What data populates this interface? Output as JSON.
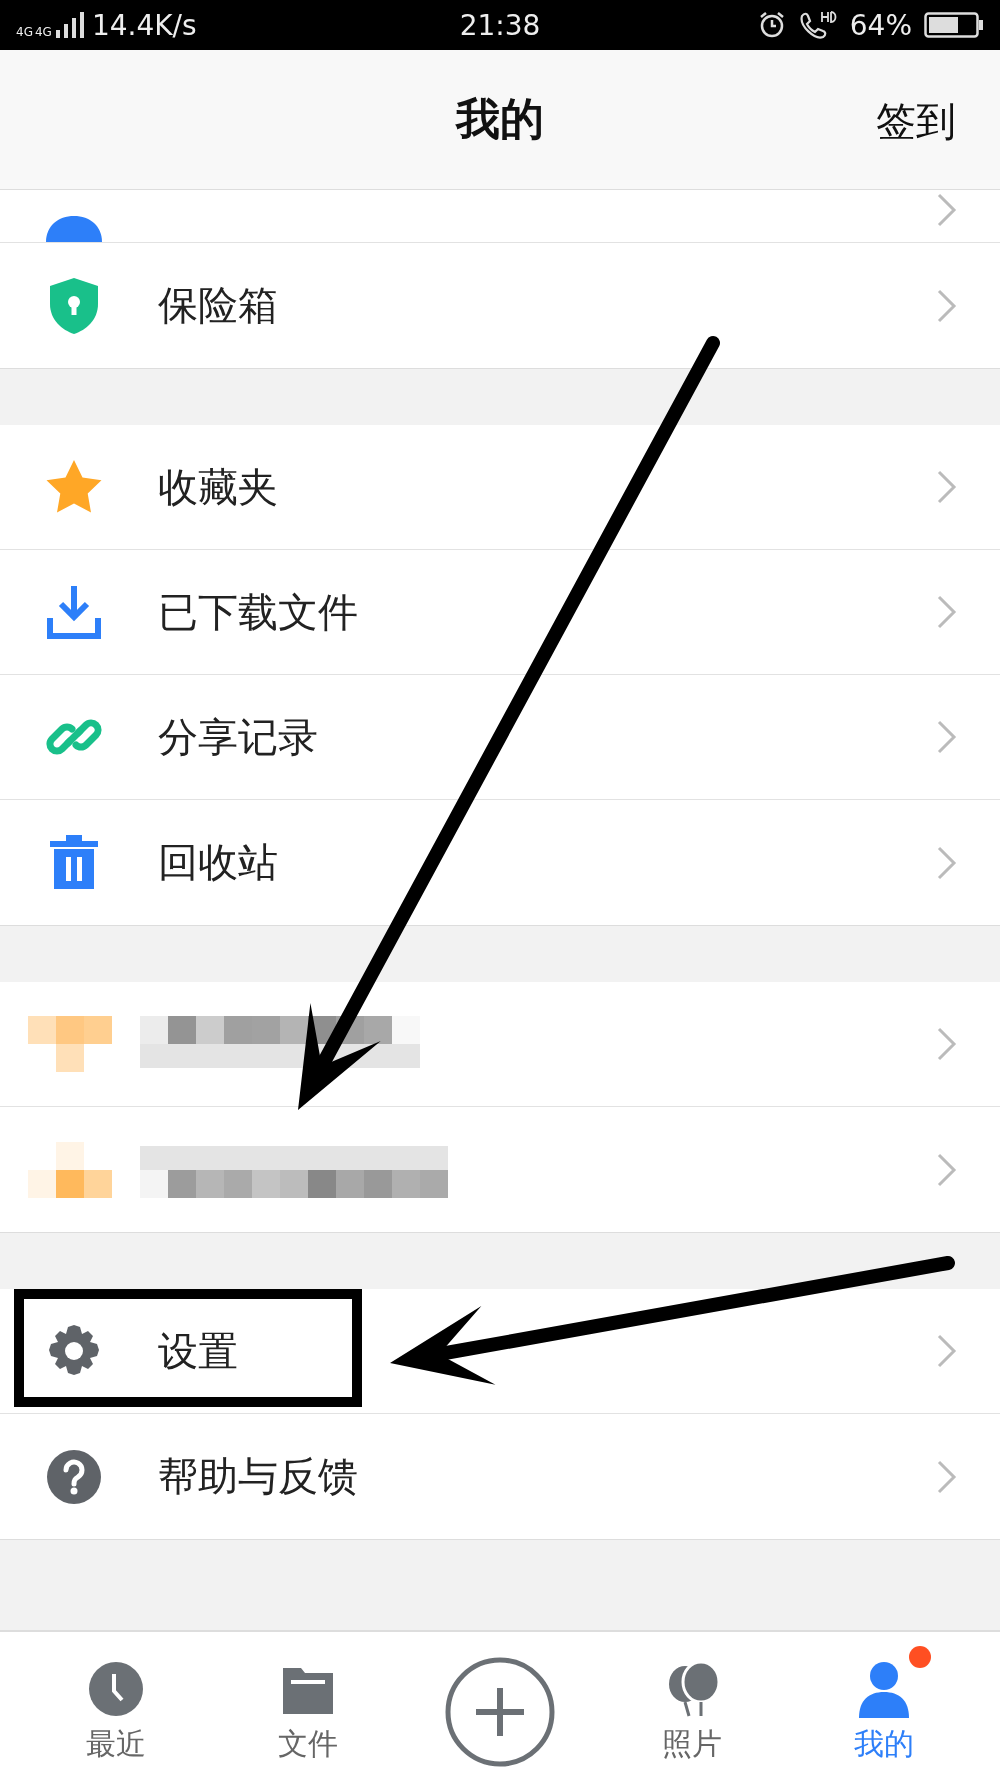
{
  "status_bar": {
    "network": [
      "4G",
      "4G"
    ],
    "speed": "14.4K/s",
    "time": "21:38",
    "battery": "64%"
  },
  "header": {
    "title": "我的",
    "action": "签到"
  },
  "sections": [
    {
      "items": [
        {
          "kind": "cut"
        },
        {
          "kind": "menu",
          "label": "保险箱"
        }
      ]
    },
    {
      "items": [
        {
          "kind": "menu",
          "label": "收藏夹"
        },
        {
          "kind": "menu",
          "label": "已下载文件"
        },
        {
          "kind": "menu",
          "label": "分享记录"
        },
        {
          "kind": "menu",
          "label": "回收站"
        }
      ]
    },
    {
      "items": [
        {
          "kind": "redacted"
        },
        {
          "kind": "redacted"
        }
      ]
    },
    {
      "items": [
        {
          "kind": "menu",
          "label": "设置",
          "highlighted": true
        },
        {
          "kind": "menu",
          "label": "帮助与反馈",
          "highlighted": false
        }
      ]
    }
  ],
  "tab_bar": [
    {
      "label": "最近",
      "selected": false,
      "badge": false
    },
    {
      "label": "文件",
      "selected": false,
      "badge": false
    },
    {
      "kind": "add"
    },
    {
      "label": "照片",
      "selected": false,
      "badge": false
    },
    {
      "label": "我的",
      "selected": true,
      "badge": true
    }
  ],
  "annotations": [
    {
      "kind": "arrow"
    },
    {
      "kind": "arrow"
    }
  ]
}
